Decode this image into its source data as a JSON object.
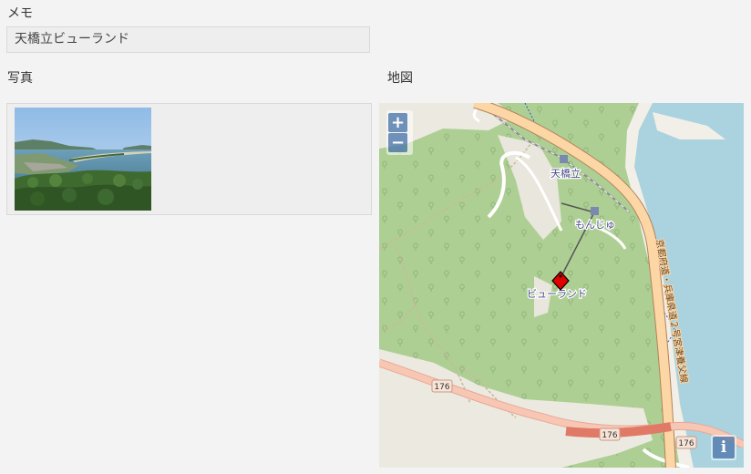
{
  "memo": {
    "label": "メモ",
    "value": "天橋立ビューランド"
  },
  "photo": {
    "label": "写真"
  },
  "map": {
    "label": "地図",
    "zoom_in": "+",
    "zoom_out": "−",
    "info": "i",
    "place_labels": {
      "station_top": "天橋立",
      "station_mid": "もんじゅ",
      "marker_label": "ビューランド"
    },
    "road_labels": {
      "route_1": "176",
      "route_2": "176",
      "route_3": "176",
      "prefectural_road": "京都府道・兵庫県道２号宮津養父線"
    },
    "colors": {
      "forest": "#aecf94",
      "water": "#aad3df",
      "trunk_road": "#f9b27c",
      "primary_road": "#fcd6a4",
      "marker": "#e00000"
    }
  }
}
